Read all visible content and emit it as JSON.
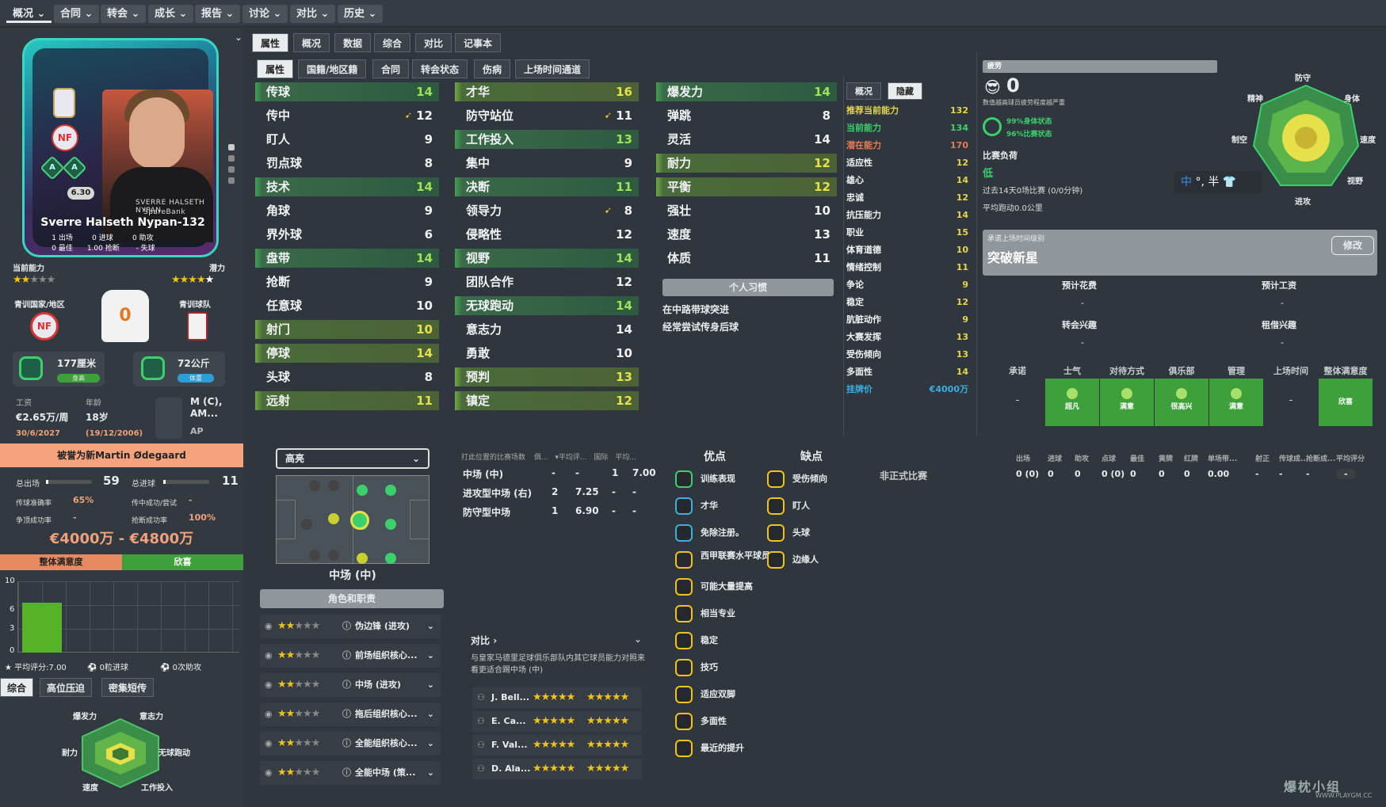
{
  "topnav": [
    "概况",
    "合同",
    "转会",
    "成长",
    "报告",
    "讨论",
    "对比",
    "历史"
  ],
  "player": {
    "name": "Sverre Halseth Nypan-132",
    "rating": "6.30",
    "shirt_name": "SVERRE HALSETH NYPAN",
    "sponsor": "SpareBank",
    "stats_line1": [
      "1",
      "出场",
      "0",
      "进球",
      "0",
      "助攻"
    ],
    "stats_line2": [
      "0",
      "最佳",
      "1.00",
      "抢断",
      "-",
      "失球"
    ],
    "current_label": "当前能力",
    "potential_label": "潜力",
    "current_stars": 2,
    "potential_stars": 5,
    "youth_nation_label": "青训国家/地区",
    "youth_club_label": "青训球队",
    "height": "177厘米",
    "height_tag": "身高",
    "weight": "72公斤",
    "weight_tag": "体重",
    "wage_label": "工资",
    "wage": "€2.65万/周",
    "age_label": "年龄",
    "age": "18岁",
    "contract": "30/6/2027",
    "dob": "(19/12/2006)",
    "position": "M (C), AM...",
    "position2": "AP",
    "comparison": "被誉为新Martin Ødegaard",
    "apps_label": "总出场",
    "apps": "59",
    "goals_label": "总进球",
    "goals": "11",
    "pass_label": "传球准确率",
    "pass": "65%",
    "cross_label": "传中成功/尝试",
    "cross": "-",
    "header_label": "争顶成功率",
    "header": "-",
    "tackle_label": "抢断成功率",
    "tackle": "100%",
    "value": "€4000万 - €4800万",
    "satisfaction_label": "整体满意度",
    "satisfaction": "欣喜",
    "chart_y": [
      "10",
      "6",
      "3",
      "0"
    ],
    "avg_rating": "平均评分:7.00",
    "goals_text": "0粒进球",
    "assists_text": "0次助攻",
    "bottom_tabs": [
      "综合",
      "高位压迫",
      "密集短传"
    ],
    "radar_small": [
      "爆发力",
      "意志力",
      "耐力",
      "无球跑动",
      "速度",
      "工作投入"
    ]
  },
  "tabs_main": [
    "属性",
    "概况",
    "数据",
    "综合",
    "对比",
    "记事本"
  ],
  "tabs_sub": [
    "属性",
    "国籍/地区籍",
    "合同",
    "转会状态",
    "伤病",
    "上场时间通道"
  ],
  "tech_attrs": [
    {
      "n": "传球",
      "v": "14",
      "hl": true
    },
    {
      "n": "传中",
      "v": "12",
      "arr": true
    },
    {
      "n": "盯人",
      "v": "9"
    },
    {
      "n": "罚点球",
      "v": "8"
    },
    {
      "n": "技术",
      "v": "14",
      "hl": true
    },
    {
      "n": "角球",
      "v": "9"
    },
    {
      "n": "界外球",
      "v": "6"
    },
    {
      "n": "盘带",
      "v": "14",
      "hl": true
    },
    {
      "n": "抢断",
      "v": "9"
    },
    {
      "n": "任意球",
      "v": "10"
    },
    {
      "n": "射门",
      "v": "10",
      "hl2": true
    },
    {
      "n": "停球",
      "v": "14",
      "hl2": true
    },
    {
      "n": "头球",
      "v": "8"
    },
    {
      "n": "远射",
      "v": "11",
      "hl2": true
    }
  ],
  "mental_attrs": [
    {
      "n": "才华",
      "v": "16",
      "hl2": true
    },
    {
      "n": "防守站位",
      "v": "11",
      "arr": true
    },
    {
      "n": "工作投入",
      "v": "13",
      "hl": true
    },
    {
      "n": "集中",
      "v": "9"
    },
    {
      "n": "决断",
      "v": "11",
      "hl": true
    },
    {
      "n": "领导力",
      "v": "8",
      "arr": true
    },
    {
      "n": "侵略性",
      "v": "12"
    },
    {
      "n": "视野",
      "v": "14",
      "hl": true
    },
    {
      "n": "团队合作",
      "v": "12"
    },
    {
      "n": "无球跑动",
      "v": "14",
      "hl": true
    },
    {
      "n": "意志力",
      "v": "14"
    },
    {
      "n": "勇敢",
      "v": "10"
    },
    {
      "n": "预判",
      "v": "13",
      "hl2": true
    },
    {
      "n": "镇定",
      "v": "12",
      "hl2": true
    }
  ],
  "physical_attrs": [
    {
      "n": "爆发力",
      "v": "14",
      "hl": true
    },
    {
      "n": "弹跳",
      "v": "8"
    },
    {
      "n": "灵活",
      "v": "14"
    },
    {
      "n": "耐力",
      "v": "12",
      "hl2": true
    },
    {
      "n": "平衡",
      "v": "12",
      "hl2": true
    },
    {
      "n": "强壮",
      "v": "10"
    },
    {
      "n": "速度",
      "v": "13"
    },
    {
      "n": "体质",
      "v": "11"
    }
  ],
  "habits_label": "个人习惯",
  "habits": [
    "在中路带球突进",
    "经常尝试传身后球"
  ],
  "hidden_tabs": [
    "概况",
    "隐藏"
  ],
  "hidden_attrs": [
    {
      "n": "推荐当前能力",
      "v": "132",
      "c": "#e6d64a"
    },
    {
      "n": "当前能力",
      "v": "134",
      "c": "#3bd06b"
    },
    {
      "n": "潜在能力",
      "v": "170",
      "c": "#e77d52"
    },
    {
      "n": "适应性",
      "v": "12"
    },
    {
      "n": "雄心",
      "v": "14"
    },
    {
      "n": "忠诚",
      "v": "12"
    },
    {
      "n": "抗压能力",
      "v": "14"
    },
    {
      "n": "职业",
      "v": "15"
    },
    {
      "n": "体育道德",
      "v": "10"
    },
    {
      "n": "情绪控制",
      "v": "11"
    },
    {
      "n": "争论",
      "v": "9"
    },
    {
      "n": "稳定",
      "v": "12"
    },
    {
      "n": "肮脏动作",
      "v": "9"
    },
    {
      "n": "大赛发挥",
      "v": "13"
    },
    {
      "n": "受伤倾向",
      "v": "13"
    },
    {
      "n": "多面性",
      "v": "14"
    },
    {
      "n": "挂牌价",
      "v": "€4000万",
      "c": "#3ab0e0"
    }
  ],
  "fatigue": {
    "label": "疲劳",
    "value": "0",
    "desc": "数值越高球员疲劳程度越严重",
    "body": "99%身体状态",
    "match": "96%比赛状态",
    "load_label": "比赛负荷",
    "load": "低",
    "last14": "过去14天0场比赛 (0/0分钟)",
    "distance": "平均跑动0.0公里"
  },
  "radar_big": [
    "防守",
    "精神",
    "身体",
    "制空",
    "速度",
    "视野",
    "进攻"
  ],
  "promise": {
    "label": "承诺上场时间级别",
    "value": "突破新星",
    "edit": "修改",
    "fee_label": "预计花费",
    "fee": "-",
    "wage_label": "预计工资",
    "wage": "-",
    "transfer_label": "转会兴趣",
    "transfer": "-",
    "loan_label": "租借兴趣",
    "loan": "-"
  },
  "morale_headers": [
    "承诺",
    "士气",
    "对待方式",
    "俱乐部",
    "管理",
    "上场时间",
    "整体满意度"
  ],
  "morale_values": [
    "-",
    "超凡",
    "满意",
    "很高兴",
    "满意",
    "-",
    "欣喜"
  ],
  "formation": {
    "highlight": "高亮",
    "position": "中场 (中)",
    "roles_label": "角色和职责"
  },
  "roles": [
    {
      "name": "伪边锋 (进攻)",
      "stars": 2
    },
    {
      "name": "前场组织核心...",
      "stars": 2
    },
    {
      "name": "中场 (进攻)",
      "stars": 2
    },
    {
      "name": "拖后组织核心...",
      "stars": 2
    },
    {
      "name": "全能组织核心...",
      "stars": 2
    },
    {
      "name": "全能中场 (策...",
      "stars": 2
    }
  ],
  "pos_table": {
    "headers": [
      "打此位置的比赛场数",
      "俱...",
      "平均评...",
      "国际",
      "平均..."
    ],
    "rows": [
      [
        "中场 (中)",
        "-",
        "-",
        "1",
        "7.00"
      ],
      [
        "进攻型中场 (右)",
        "2",
        "7.25",
        "-",
        "-"
      ],
      [
        "防守型中场",
        "1",
        "6.90",
        "-",
        "-"
      ]
    ]
  },
  "compare": {
    "label": "对比",
    "desc": "与皇家马德里足球俱乐部队内其它球员能力对照来看更适合踢中场 (中)",
    "players": [
      "J. Bell...",
      "E. Ca...",
      "F. Val...",
      "D. Ala..."
    ]
  },
  "pros_label": "优点",
  "pros": [
    "训练表现",
    "才华",
    "免除注册。",
    "西甲联赛水平球员",
    "可能大量提高",
    "相当专业",
    "稳定",
    "技巧",
    "适应双脚",
    "多面性",
    "最近的提升"
  ],
  "cons_label": "缺点",
  "cons": [
    "受伤倾向",
    "盯人",
    "头球",
    "边缘人"
  ],
  "match_stats": {
    "headers": [
      "出场",
      "进球",
      "助攻",
      "点球",
      "最佳",
      "黄牌",
      "红牌",
      "单场带...",
      "射正",
      "传球成...",
      "抢断成...",
      "平均评分"
    ],
    "row_label": "非正式比赛",
    "row": [
      "0 (0)",
      "0",
      "0",
      "0 (0)",
      "0",
      "0",
      "0",
      "0.00",
      "-",
      "-",
      "-",
      "-"
    ]
  },
  "watermark": "爆枕小组",
  "watermark_url": "WWW.PLAYGM.CC"
}
